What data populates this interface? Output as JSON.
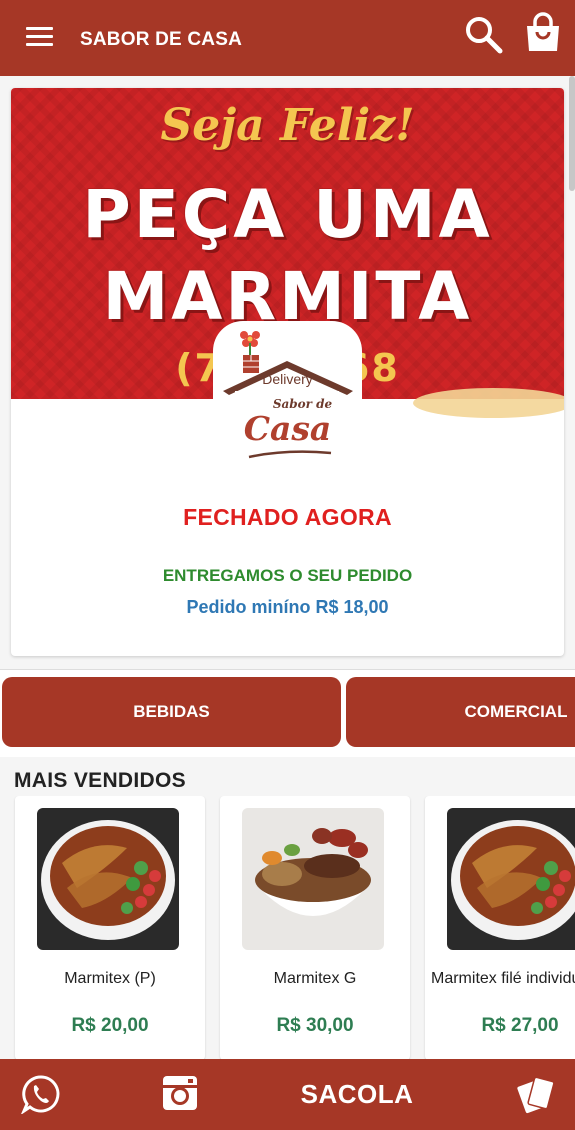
{
  "header": {
    "title": "SABOR DE CASA",
    "menu_icon": "hamburger-menu-icon",
    "search_icon": "search-icon",
    "bag_icon": "shopping-bag-icon"
  },
  "banner": {
    "script_text": "Seja Feliz!",
    "line1": "PEÇA UMA",
    "line2": "MARMITA",
    "phone": "(77)          3668"
  },
  "logo": {
    "top_text": "Delivery",
    "brand_small": "Sabor de",
    "brand_big": "Casa"
  },
  "store": {
    "status": "FECHADO AGORA",
    "delivery": "ENTREGAMOS O SEU PEDIDO",
    "min_order": "Pedido miníno R$ 18,00"
  },
  "categories": [
    {
      "label": "BEBIDAS"
    },
    {
      "label": "COMERCIAL"
    }
  ],
  "section": {
    "title": "MAIS VENDIDOS"
  },
  "products": [
    {
      "name": "Marmitex (P)",
      "price": "R$ 20,00"
    },
    {
      "name": "Marmitex G",
      "price": "R$ 30,00"
    },
    {
      "name": "Marmitex filé individual",
      "price": "R$ 27,00"
    }
  ],
  "bottom_bar": {
    "sacola_label": "SACOLA",
    "icons": [
      "whatsapp-icon",
      "instagram-icon",
      "cards-icon"
    ]
  },
  "colors": {
    "brand": "#a63726",
    "closed": "#e0201f",
    "delivery": "#2e8b2e",
    "min_order": "#2f78b4",
    "price": "#2e7d52"
  }
}
